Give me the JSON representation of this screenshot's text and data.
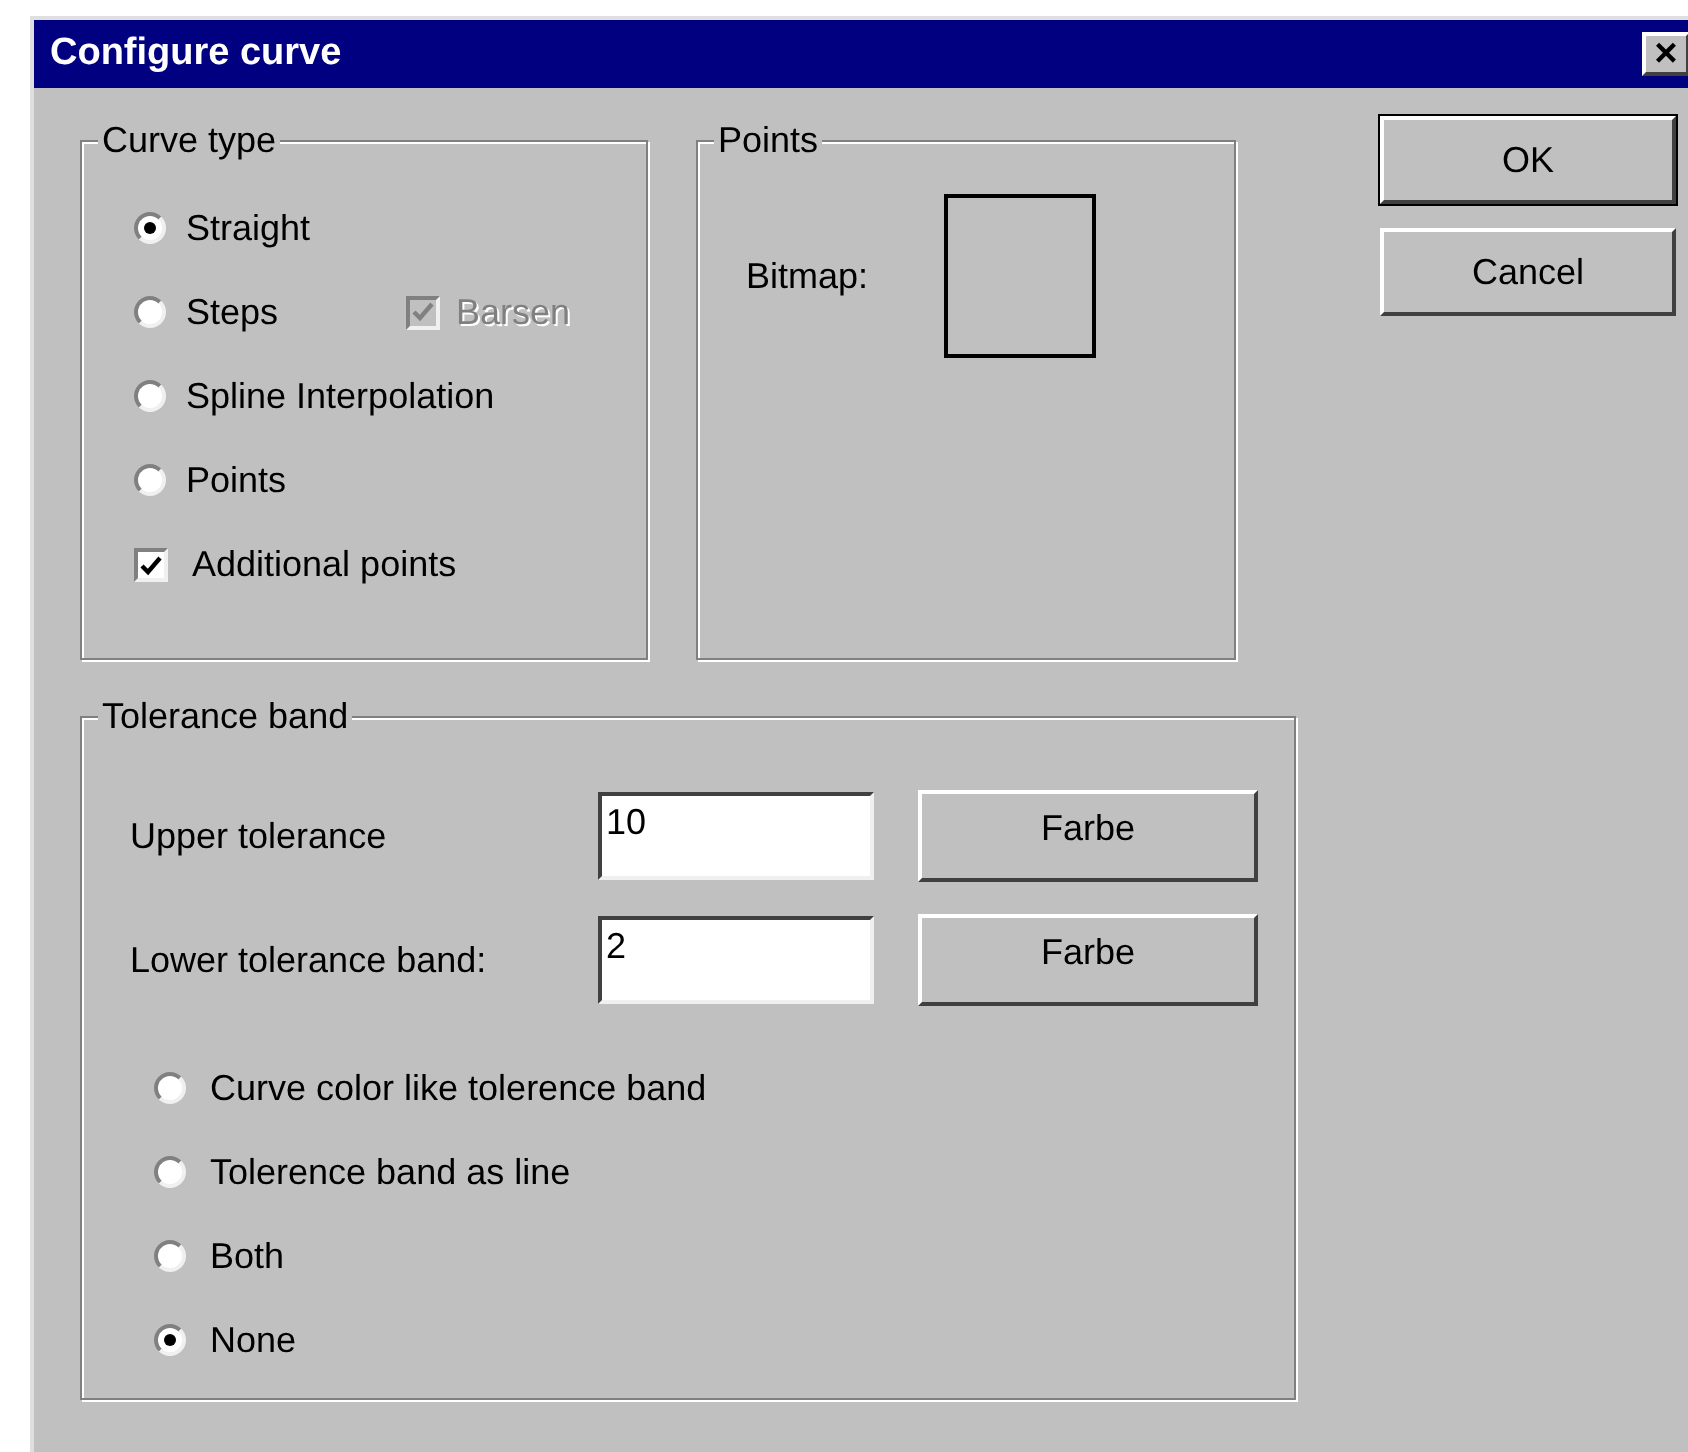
{
  "window": {
    "title": "Configure curve",
    "close": "×"
  },
  "curve_type": {
    "title": "Curve type",
    "options": [
      {
        "label": "Straight",
        "selected": true
      },
      {
        "label": "Steps",
        "selected": false
      },
      {
        "label": "Spline Interpolation",
        "selected": false
      },
      {
        "label": "Points",
        "selected": false
      }
    ],
    "barsen": {
      "label": "Barsen",
      "checked": true,
      "disabled": true
    },
    "additional_points": {
      "label": "Additional points",
      "checked": true
    }
  },
  "points": {
    "title": "Points",
    "bitmap_label": "Bitmap:"
  },
  "buttons": [
    {
      "label": "OK",
      "default": true
    },
    {
      "label": "Cancel",
      "default": false
    }
  ],
  "tolerance_band": {
    "title": "Tolerance band",
    "fields": [
      {
        "label": "Upper tolerance",
        "value": "10",
        "button": "Farbe"
      },
      {
        "label": "Lower tolerance band:",
        "value": "2",
        "button": "Farbe"
      }
    ],
    "options": [
      {
        "label": "Curve color like tolerence band",
        "selected": false
      },
      {
        "label": "Tolerence band as line",
        "selected": false
      },
      {
        "label": "Both",
        "selected": false
      },
      {
        "label": "None",
        "selected": true
      }
    ]
  }
}
